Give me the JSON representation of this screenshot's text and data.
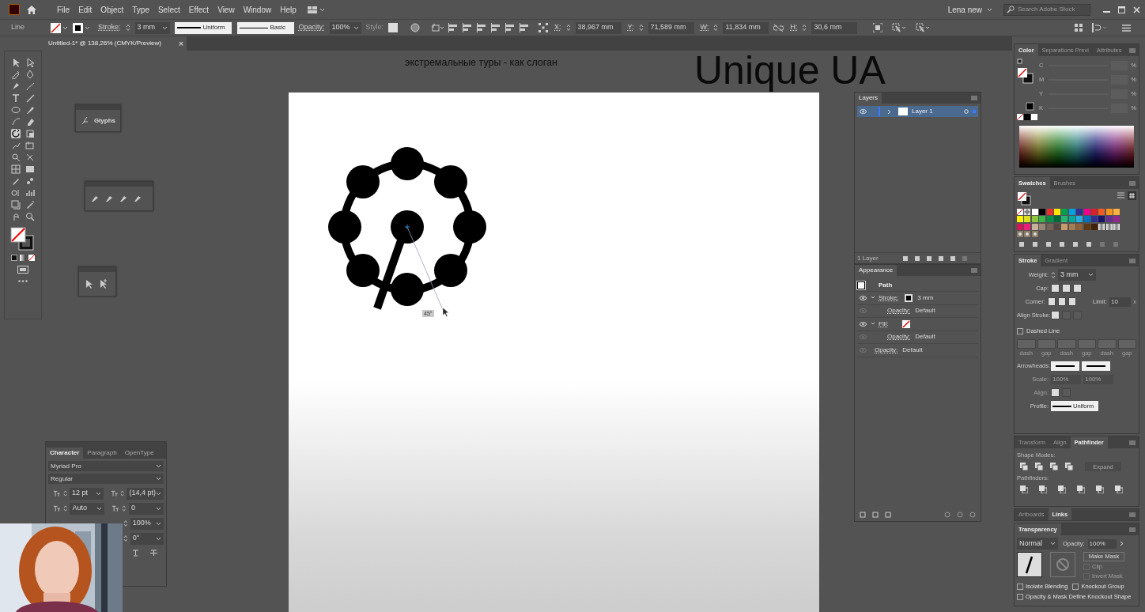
{
  "menu_bar": {
    "items": [
      "File",
      "Edit",
      "Object",
      "Type",
      "Select",
      "Effect",
      "View",
      "Window",
      "Help"
    ],
    "user": "Lena new",
    "search": {
      "placeholder": "Search Adobe Stock"
    }
  },
  "control_bar": {
    "selection": "Line",
    "stroke_label": "Stroke:",
    "stroke_weight": "3 mm",
    "profile": "Uniform",
    "brush": "Basic",
    "opacity_label": "Opacity:",
    "opacity": "100%",
    "style_label": "Style:",
    "transform": [
      {
        "label": "X:",
        "value": "38,967 mm"
      },
      {
        "label": "Y:",
        "value": "71,589 mm"
      },
      {
        "label": "W:",
        "value": "11,834 mm"
      },
      {
        "label": "H:",
        "value": "30,6 mm"
      }
    ]
  },
  "document_tab": {
    "title": "Untitled-1* @ 138,26% (CMYK/Preview)",
    "close": "×"
  },
  "canvas": {
    "slogan": "экстремальные туры - как слоган",
    "headline": "Unique UA",
    "angle_label": "45°"
  },
  "glyphs_panel": {
    "label": "Glyphs"
  },
  "layers_panel": {
    "tab": "Layers",
    "layers": [
      {
        "name": "Layer 1",
        "selected": true,
        "visible": true
      }
    ],
    "count": "1 Layer"
  },
  "appearance_panel": {
    "tab": "Appearance",
    "object": "Path",
    "rows": [
      {
        "kind": "stroke",
        "label": "Stroke:",
        "value": "3 mm",
        "visible": true
      },
      {
        "kind": "opacity",
        "label": "Opacity:",
        "value": "Default",
        "visible": false
      },
      {
        "kind": "fill",
        "label": "Fill:",
        "visible": true
      },
      {
        "kind": "opacity",
        "label": "Opacity:",
        "value": "Default",
        "visible": false
      },
      {
        "kind": "object_opacity",
        "label": "Opacity:",
        "value": "Default",
        "visible": false
      }
    ]
  },
  "character_panel": {
    "tabs": [
      {
        "label": "Character",
        "selected": true
      },
      {
        "label": "Paragraph",
        "selected": false
      },
      {
        "label": "OpenType",
        "selected": false
      }
    ],
    "font": "Myriad Pro",
    "style": "Regular",
    "size": "12 pt",
    "leading": "(14,4 pt)",
    "kerning": "Auto",
    "tracking": "0",
    "scale": "100%",
    "rotation": "0°"
  },
  "color_panel": {
    "tabs": [
      {
        "label": "Color",
        "selected": true
      },
      {
        "label": "Separations Previ",
        "selected": false
      },
      {
        "label": "Attributes",
        "selected": false
      }
    ],
    "channels": [
      {
        "label": "C",
        "unit": "%"
      },
      {
        "label": "M",
        "unit": "%"
      },
      {
        "label": "Y",
        "unit": "%"
      },
      {
        "label": "K",
        "unit": "%"
      }
    ]
  },
  "swatches_panel": {
    "tabs": [
      {
        "label": "Swatches",
        "selected": true
      },
      {
        "label": "Brushes",
        "selected": false
      }
    ],
    "swatches": [
      {
        "kind": "none"
      },
      {
        "kind": "registration"
      },
      {
        "kind": "color",
        "color": "#ffffff"
      },
      {
        "kind": "color",
        "color": "#000000"
      },
      {
        "kind": "color",
        "color": "#e8312a"
      },
      {
        "kind": "color",
        "color": "#ffe600"
      },
      {
        "kind": "color",
        "color": "#00a04f"
      },
      {
        "kind": "color",
        "color": "#00a0e3"
      },
      {
        "kind": "color",
        "color": "#2e3192"
      },
      {
        "kind": "color",
        "color": "#ec008c"
      },
      {
        "kind": "color",
        "color": "#d7202a"
      },
      {
        "kind": "color",
        "color": "#f15a24"
      },
      {
        "kind": "color",
        "color": "#f7941d"
      },
      {
        "kind": "color",
        "color": "#fbb040"
      },
      {
        "kind": "color",
        "color": "#fff200"
      },
      {
        "kind": "color",
        "color": "#d9e021"
      },
      {
        "kind": "color",
        "color": "#8cc63f"
      },
      {
        "kind": "color",
        "color": "#39b54a"
      },
      {
        "kind": "color",
        "color": "#009245"
      },
      {
        "kind": "color",
        "color": "#006837"
      },
      {
        "kind": "color",
        "color": "#22b573"
      },
      {
        "kind": "color",
        "color": "#00a99d"
      },
      {
        "kind": "color",
        "color": "#29abe2"
      },
      {
        "kind": "color",
        "color": "#0071bc"
      },
      {
        "kind": "color",
        "color": "#2e3192"
      },
      {
        "kind": "color",
        "color": "#1b1464"
      },
      {
        "kind": "color",
        "color": "#662d91"
      },
      {
        "kind": "color",
        "color": "#93278f"
      },
      {
        "kind": "color",
        "color": "#d4145a"
      },
      {
        "kind": "color",
        "color": "#ed1e79"
      },
      {
        "kind": "color",
        "color": "#c7b299"
      },
      {
        "kind": "color",
        "color": "#998675"
      },
      {
        "kind": "color",
        "color": "#736357"
      },
      {
        "kind": "color",
        "color": "#534741"
      },
      {
        "kind": "color",
        "color": "#c69c6d"
      },
      {
        "kind": "color",
        "color": "#a67c52"
      },
      {
        "kind": "color",
        "color": "#8c6239"
      },
      {
        "kind": "color",
        "color": "#603813"
      },
      {
        "kind": "color",
        "color": "#42210b"
      },
      {
        "kind": "gradient"
      },
      {
        "kind": "gradient"
      },
      {
        "kind": "gradient"
      },
      {
        "kind": "pattern"
      },
      {
        "kind": "pattern"
      },
      {
        "kind": "pattern"
      }
    ]
  },
  "stroke_panel": {
    "tabs": [
      {
        "label": "Stroke",
        "selected": true
      },
      {
        "label": "Gradient",
        "selected": false
      }
    ],
    "weight_label": "Weight:",
    "weight": "3 mm",
    "cap_label": "Cap:",
    "corner_label": "Corner:",
    "limit_label": "Limit:",
    "limit": "10",
    "limit_unit": "x",
    "align_label": "Align Stroke:",
    "dashed": {
      "label": "Dashed Line",
      "checked": false
    },
    "dash_fields": [
      "dash",
      "gap",
      "dash",
      "gap",
      "dash",
      "gap"
    ],
    "arrowheads_label": "Arrowheads:",
    "scale_label": "Scale:",
    "scale": [
      "100%",
      "100%"
    ],
    "arrow_align_label": "Align:",
    "profile_label": "Profile:",
    "profile": "Uniform"
  },
  "pathfinder_panel": {
    "tabs": [
      {
        "label": "Transform",
        "selected": false
      },
      {
        "label": "Align",
        "selected": false
      },
      {
        "label": "Pathfinder",
        "selected": true
      }
    ],
    "shape_modes": "Shape Modes:",
    "expand": "Expand",
    "pathfinders": "Pathfinders:"
  },
  "artboards_panel": {
    "tabs": [
      {
        "label": "Artboards",
        "selected": false
      },
      {
        "label": "Links",
        "selected": true
      }
    ]
  },
  "transparency_panel": {
    "tab": "Transparency",
    "blend": "Normal",
    "opacity_label": "Opacity:",
    "opacity": "100%",
    "make_mask": "Make Mask",
    "checks": [
      {
        "label": "Clip",
        "checked": false,
        "disabled": true
      },
      {
        "label": "Invert Mask",
        "checked": false,
        "disabled": true
      },
      {
        "label": "Isolate Blending",
        "checked": false,
        "disabled": false
      },
      {
        "label": "Knockout Group",
        "checked": false,
        "disabled": false
      },
      {
        "label": "Opacity & Mask Define Knockout Shape",
        "checked": false,
        "disabled": false
      }
    ]
  }
}
